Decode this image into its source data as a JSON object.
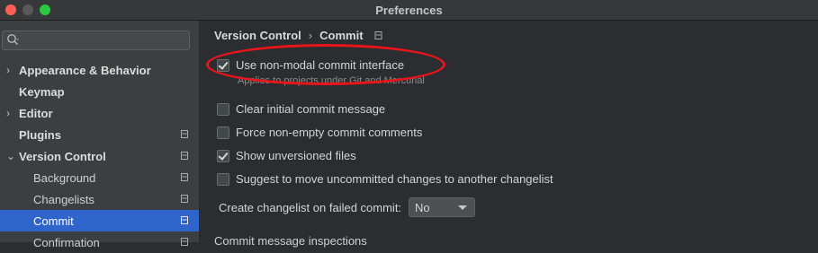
{
  "window": {
    "title": "Preferences"
  },
  "sidebar": {
    "search_placeholder": "",
    "items": [
      {
        "label": "Appearance & Behavior",
        "arrow": "›"
      },
      {
        "label": "Keymap"
      },
      {
        "label": "Editor",
        "arrow": "›"
      },
      {
        "label": "Plugins"
      },
      {
        "label": "Version Control",
        "arrow": "⌄"
      },
      {
        "label": "Background"
      },
      {
        "label": "Changelists"
      },
      {
        "label": "Commit"
      },
      {
        "label": "Confirmation"
      }
    ]
  },
  "breadcrumb": {
    "first": "Version Control",
    "separator": "›",
    "second": "Commit"
  },
  "options": {
    "non_modal": "Use non-modal commit interface",
    "non_modal_hint": "Applies to projects under Git and Mercurial",
    "clear_message": "Clear initial commit message",
    "force_non_empty": "Force non-empty commit comments",
    "show_unversioned": "Show unversioned files",
    "suggest_move": "Suggest to move uncommitted changes to another changelist"
  },
  "failed_commit": {
    "label": "Create changelist on failed commit:",
    "value": "No"
  },
  "section_header": "Commit message inspections",
  "colors": {
    "selection": "#2f65ca",
    "annotation": "#e8151b"
  }
}
